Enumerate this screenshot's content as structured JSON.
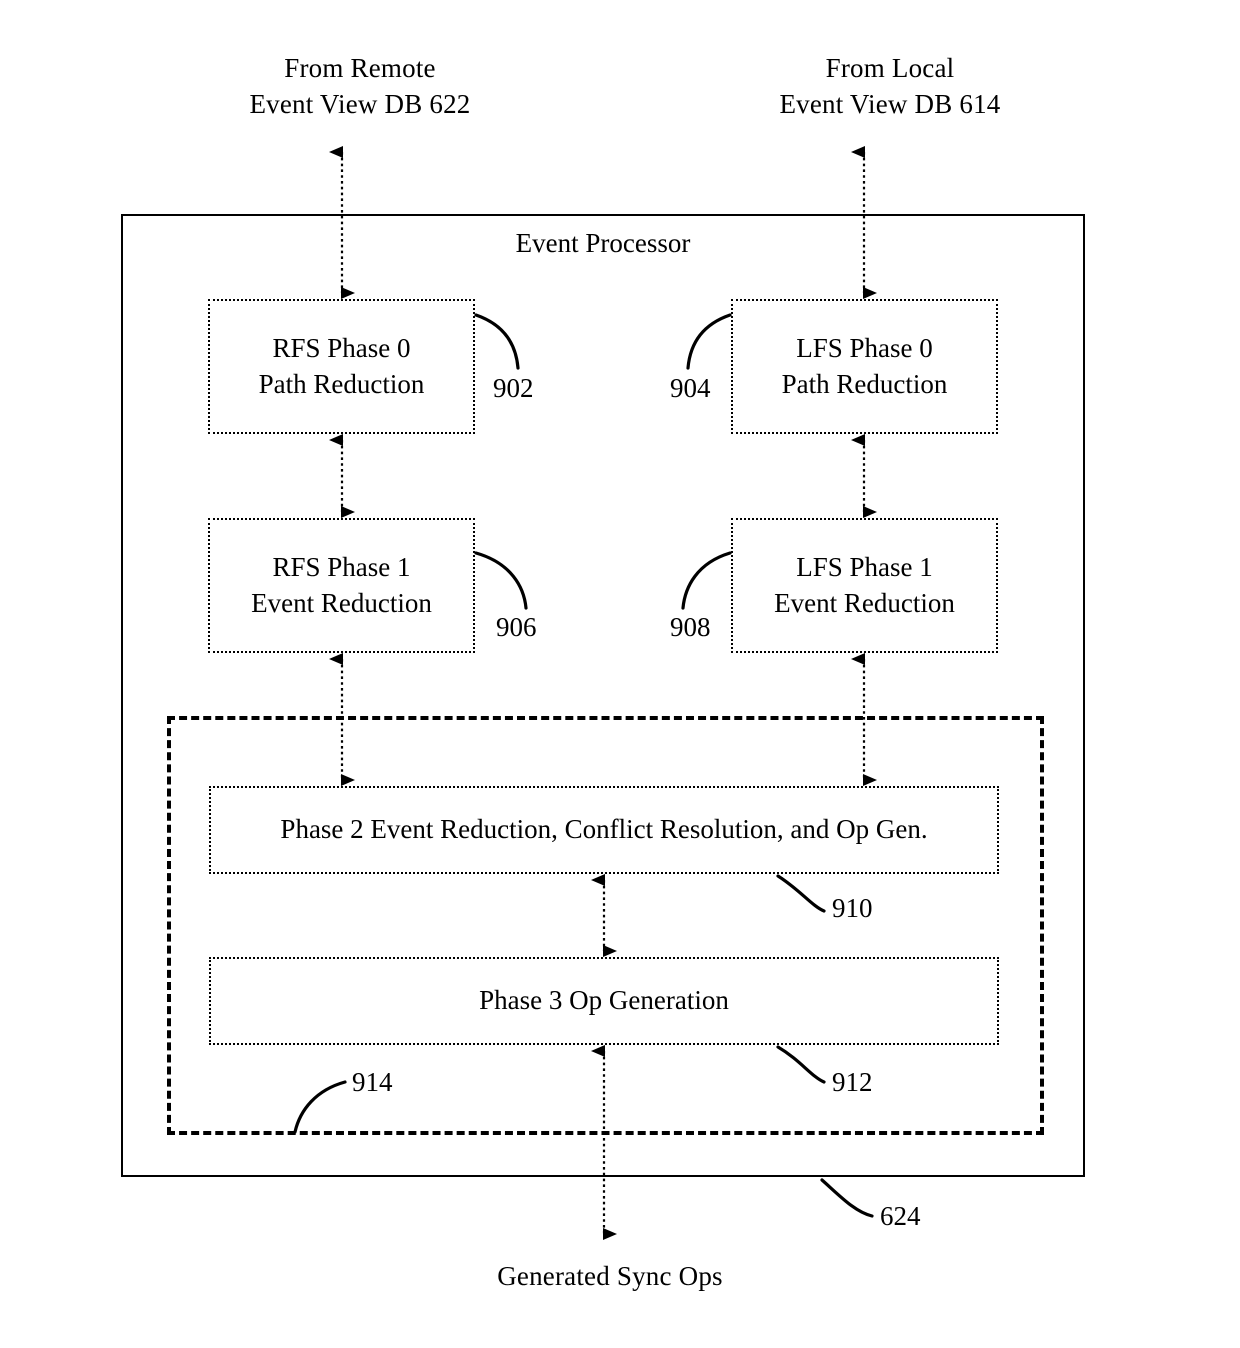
{
  "figure": {
    "type": "patent-block-diagram",
    "background": "#ffffff",
    "line_color": "#000000"
  },
  "external_labels": {
    "top_left": "From Remote\nEvent View DB 622",
    "top_right": "From Local\nEvent View DB 614",
    "bottom": "Generated Sync Ops"
  },
  "processor": {
    "title": "Event Processor",
    "ref": "624"
  },
  "group": {
    "ref": "914"
  },
  "blocks": [
    {
      "id": "rfs0",
      "label": "RFS Phase 0\nPath Reduction",
      "ref": "902"
    },
    {
      "id": "lfs0",
      "label": "LFS Phase 0\nPath Reduction",
      "ref": "904"
    },
    {
      "id": "rfs1",
      "label": "RFS Phase 1\nEvent Reduction",
      "ref": "906"
    },
    {
      "id": "lfs1",
      "label": "LFS Phase 1\nEvent Reduction",
      "ref": "908"
    },
    {
      "id": "phase2",
      "label": "Phase 2 Event Reduction, Conflict Resolution, and Op Gen.",
      "ref": "910"
    },
    {
      "id": "phase3",
      "label": "Phase 3 Op Generation",
      "ref": "912"
    }
  ]
}
